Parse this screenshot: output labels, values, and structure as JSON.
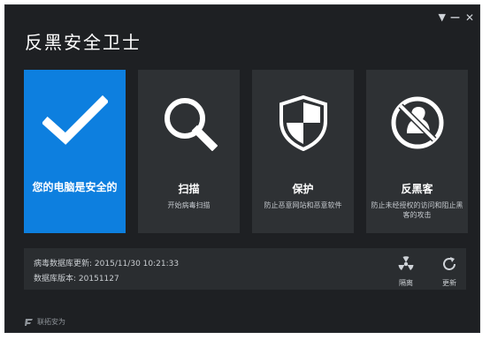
{
  "app": {
    "title": "反黑安全卫士"
  },
  "window_controls": {
    "menu": "▼",
    "minimize": "—",
    "close": "✕"
  },
  "tiles": [
    {
      "label": "您的电脑是安全的",
      "desc": "",
      "icon": "checkmark-icon",
      "active": true
    },
    {
      "label": "扫描",
      "desc": "开始病毒扫描",
      "icon": "magnifier-icon"
    },
    {
      "label": "保护",
      "desc": "防止恶意网站和恶意软件",
      "icon": "shield-icon"
    },
    {
      "label": "反黑客",
      "desc": "防止未经授权的访问和阻止黑客的攻击",
      "icon": "anti-hacker-icon"
    }
  ],
  "info": {
    "db_update_label": "病毒数据库更新:",
    "db_update_value": "2015/11/30 10:21:33",
    "db_version_label": "数据库版本:",
    "db_version_value": "20151127"
  },
  "tools": [
    {
      "label": "隔离",
      "icon": "radiation-icon"
    },
    {
      "label": "更新",
      "icon": "refresh-icon"
    }
  ],
  "brand": {
    "text": "联拓安为",
    "icon": "brand-logo-icon"
  },
  "colors": {
    "accent": "#0d7fdf",
    "tile": "#2e3134",
    "background": "#1e2023"
  }
}
